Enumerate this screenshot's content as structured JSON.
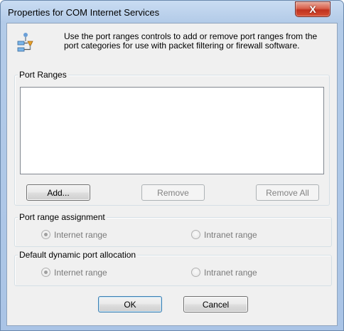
{
  "window": {
    "title": "Properties for COM Internet Services",
    "close_glyph": "X"
  },
  "header": {
    "icon": "port-network-icon",
    "text": "Use the port ranges controls to add or remove port ranges from the port categories for use with packet filtering or firewall software."
  },
  "port_ranges": {
    "label": "Port Ranges",
    "items": [],
    "buttons": {
      "add": "Add...",
      "remove": "Remove",
      "remove_all": "Remove All"
    }
  },
  "port_range_assignment": {
    "label": "Port range assignment",
    "options": [
      {
        "label": "Internet range",
        "checked": true
      },
      {
        "label": "Intranet range",
        "checked": false
      }
    ]
  },
  "default_dynamic_port_allocation": {
    "label": "Default dynamic port allocation",
    "options": [
      {
        "label": "Internet range",
        "checked": true
      },
      {
        "label": "Intranet range",
        "checked": false
      }
    ]
  },
  "footer": {
    "ok": "OK",
    "cancel": "Cancel"
  }
}
